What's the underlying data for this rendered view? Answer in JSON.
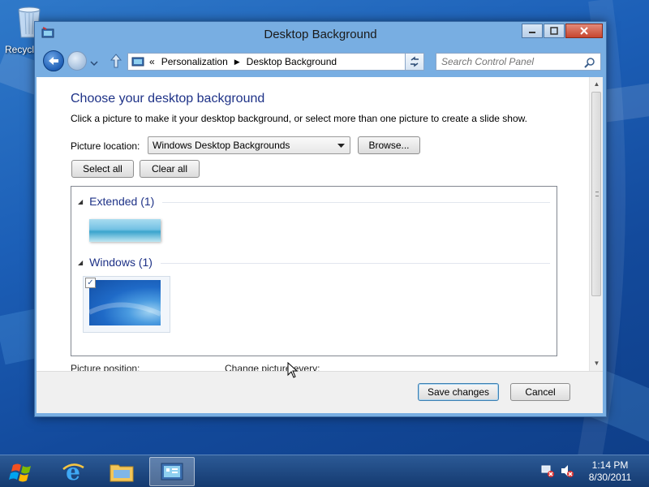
{
  "desktop": {
    "recycle_bin_label": "Recycle Bin"
  },
  "window": {
    "title": "Desktop Background",
    "address": {
      "overflow": "«",
      "crumbs": [
        "Personalization",
        "Desktop Background"
      ]
    },
    "search_placeholder": "Search Control Panel"
  },
  "page": {
    "heading": "Choose your desktop background",
    "description": "Click a picture to make it your desktop background, or select more than one picture to create a slide show.",
    "picture_location_label": "Picture location:",
    "picture_location_value": "Windows Desktop Backgrounds",
    "browse_label": "Browse...",
    "select_all_label": "Select all",
    "clear_all_label": "Clear all",
    "groups": [
      {
        "label": "Extended (1)"
      },
      {
        "label": "Windows (1)",
        "selected": true
      }
    ],
    "picture_position_label": "Picture position:",
    "change_picture_label": "Change picture every:"
  },
  "footer": {
    "save_label": "Save changes",
    "cancel_label": "Cancel"
  },
  "taskbar": {
    "time": "1:14 PM",
    "date": "8/30/2011"
  },
  "colors": {
    "heading": "#1e3287",
    "window_chrome": "#78aee2",
    "taskbar": "#143a70"
  }
}
